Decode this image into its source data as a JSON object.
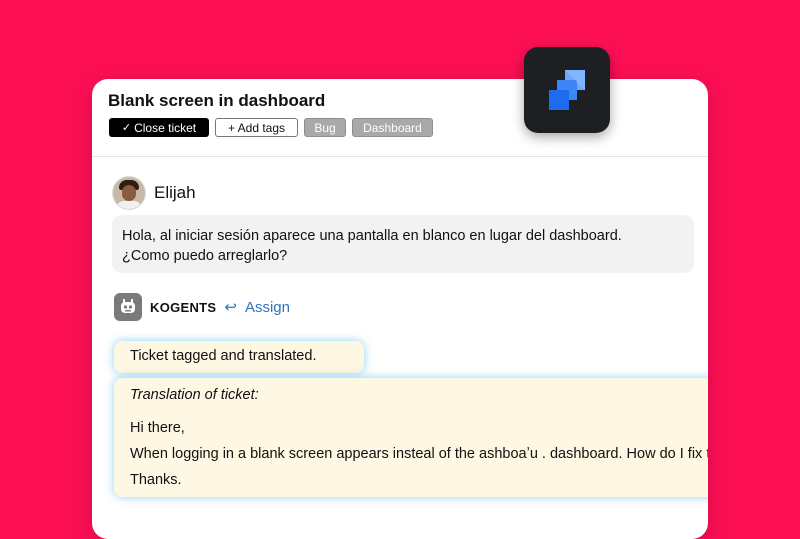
{
  "ticket": {
    "title": "Blank screen in dashboard",
    "close_label": "Close ticket",
    "add_tags_label": "+ Add tags",
    "tags": [
      "Bug",
      "Dashboard"
    ]
  },
  "user": {
    "name": "Elijah",
    "message_lines": [
      "Hola, al iniciar sesión aparece una pantalla en blanco en lugar del dashboard.",
      "¿Como puedo arreglarlo?"
    ]
  },
  "bot": {
    "name": "KOGENTS",
    "assign_label": "Assign",
    "status": "Ticket tagged and translated.",
    "translation_title": "Translation of ticket:",
    "translation_lines": [
      "Hi there,",
      "When logging in a blank screen appears insteal of the ashboaʼu . dashboard. How do I fix this?",
      "Thanks."
    ]
  },
  "colors": {
    "background": "#fd0f55",
    "card": "#ffffff",
    "accent_link": "#2f74c0",
    "bot_bubble": "#fdf7e3",
    "tag_gray": "#a9a9a9"
  },
  "icons": {
    "close_check": "check-icon",
    "assign": "undo-arrow-icon",
    "bot": "robot-icon",
    "app_badge": "jira-logo-icon"
  }
}
